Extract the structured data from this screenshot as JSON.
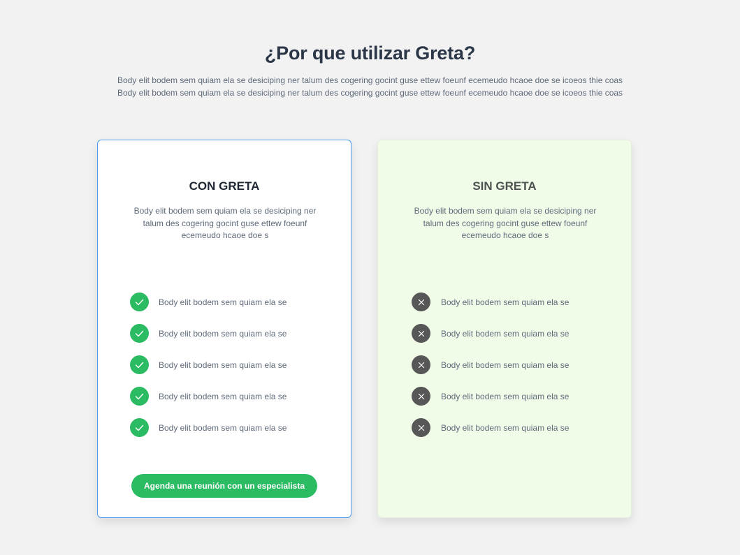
{
  "header": {
    "title": "¿Por que utilizar Greta?",
    "intro_line_1": "Body elit bodem sem quiam ela se desiciping ner talum des cogering gocint guse ettew foeunf ecemeudo hcaoe doe se icoeos thie coas",
    "intro_line_2": "Body elit bodem sem quiam ela se desiciping ner talum des cogering gocint guse ettew foeunf ecemeudo hcaoe doe se icoeos thie coas"
  },
  "with_greta": {
    "title": "CON GRETA",
    "description": "Body elit bodem sem quiam ela se desiciping ner talum des cogering gocint guse ettew foeunf ecemeudo hcaoe doe s",
    "features": [
      "Body elit bodem sem quiam ela se",
      "Body elit bodem sem quiam ela se",
      "Body elit bodem sem quiam ela se",
      "Body elit bodem sem quiam ela se",
      "Body elit bodem sem quiam ela se"
    ],
    "icon": "check-circle-icon",
    "cta_label": "Agenda una reunión con un especialista"
  },
  "without_greta": {
    "title": "SIN GRETA",
    "description": "Body elit bodem sem quiam ela se desiciping ner talum des cogering gocint guse ettew foeunf ecemeudo hcaoe doe s",
    "features": [
      "Body elit bodem sem quiam ela se",
      "Body elit bodem sem quiam ela se",
      "Body elit bodem sem quiam ela se",
      "Body elit bodem sem quiam ela se",
      "Body elit bodem sem quiam ela se"
    ],
    "icon": "cross-circle-icon"
  },
  "colors": {
    "background": "#f2f2f2",
    "title": "#2b3647",
    "body_text": "#5e6a7a",
    "accent_green": "#2bbb62",
    "card_border_blue": "#4a9df2",
    "without_card_bg": "#f0fce8",
    "cross_icon_bg": "#575757"
  }
}
